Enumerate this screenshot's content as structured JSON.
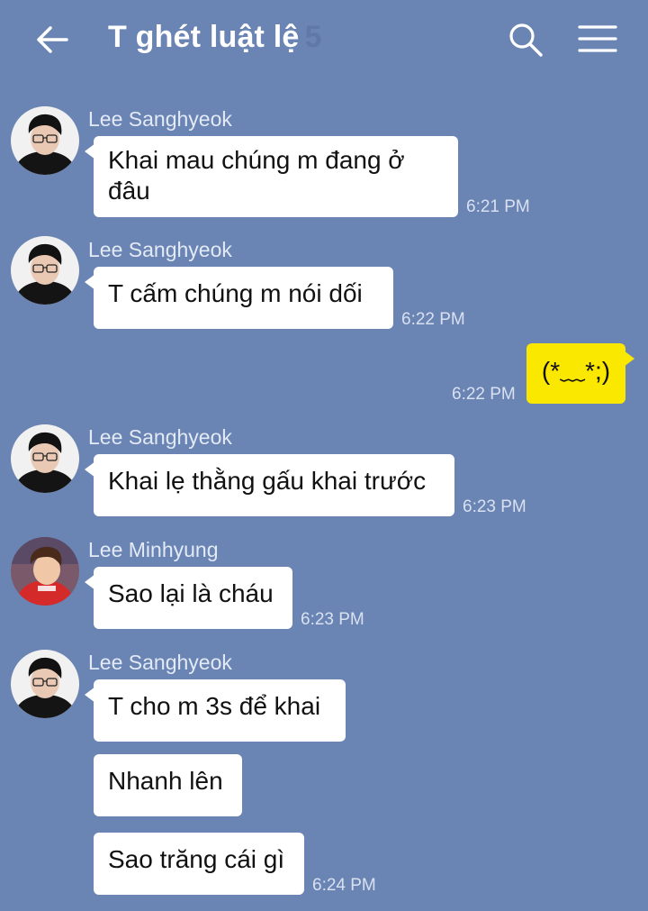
{
  "header": {
    "title": "T ghét luật lệ",
    "member_count": "5",
    "icons": {
      "back": "back-arrow-icon",
      "search": "search-icon",
      "menu": "hamburger-menu-icon"
    }
  },
  "colors": {
    "background": "#6a84b4",
    "bubble_incoming": "#ffffff",
    "bubble_outgoing": "#fbe800",
    "sender_text": "#e3eaf6",
    "timestamp_text": "#d9e1f0"
  },
  "messages": [
    {
      "sender": "Lee Sanghyeok",
      "text_lines": [
        "Khai mau chúng m đang ở",
        "đâu"
      ],
      "time": "6:21 PM"
    },
    {
      "sender": "Lee Sanghyeok",
      "text": "T cấm chúng m nói dối",
      "time": "6:22 PM"
    },
    {
      "sender": "me",
      "text": "(*﹏*;)",
      "time": "6:22 PM"
    },
    {
      "sender": "Lee Sanghyeok",
      "text": "Khai lẹ thằng gấu khai trước",
      "time": "6:23 PM"
    },
    {
      "sender": "Lee Minhyung",
      "text": "Sao lại là cháu",
      "time": "6:23 PM"
    },
    {
      "sender": "Lee Sanghyeok",
      "text": "T cho m 3s để khai",
      "time": ""
    },
    {
      "sender": "Lee Sanghyeok",
      "text": "Nhanh lên",
      "time": ""
    },
    {
      "sender": "Lee Sanghyeok",
      "text": "Sao trăng cái gì",
      "time": "6:24 PM"
    }
  ]
}
